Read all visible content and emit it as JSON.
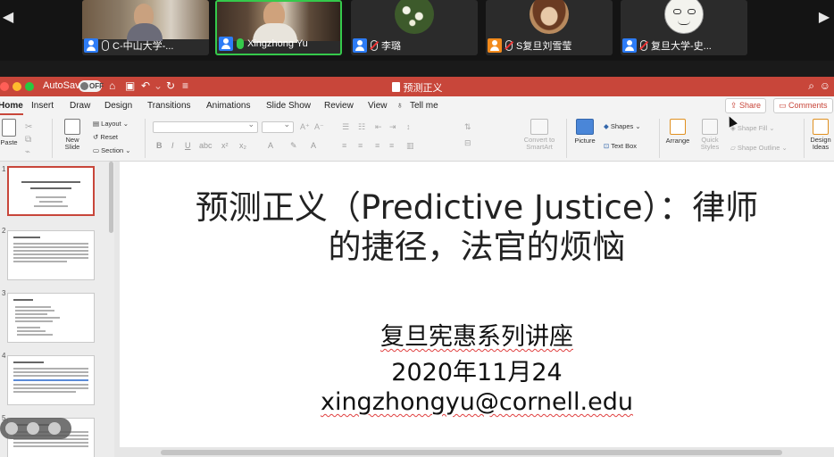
{
  "zoom": {
    "participants": [
      {
        "name": "C-中山大学-...",
        "mic": "on",
        "video": true,
        "icon": "user-icon"
      },
      {
        "name": "Xingzhong Yu",
        "mic": "speaking",
        "video": true,
        "active": true,
        "icon": "user-icon"
      },
      {
        "name": "李璐",
        "mic": "muted",
        "video": false,
        "avatar": "flowers",
        "icon": "user-icon"
      },
      {
        "name": "S复旦刘雪莹",
        "mic": "muted",
        "video": false,
        "avatar": "woman-photo",
        "icon": "user-icon-orange"
      },
      {
        "name": "复旦大学-史...",
        "mic": "muted",
        "video": false,
        "avatar": "cartoon-face",
        "icon": "user-icon"
      }
    ]
  },
  "window": {
    "autosave_label": "AutoSave",
    "autosave_state": "OFF",
    "doc_title": "预测正义"
  },
  "ribbon": {
    "tabs": [
      "Home",
      "Insert",
      "Draw",
      "Design",
      "Transitions",
      "Animations",
      "Slide Show",
      "Review",
      "View",
      "Tell me"
    ],
    "selected_tab": "Home",
    "share_label": "Share",
    "comments_label": "Comments",
    "paste_label": "Paste",
    "new_slide_label": "New Slide",
    "layout_label": "Layout",
    "reset_label": "Reset",
    "section_label": "Section",
    "convert_label": "Convert to SmartArt",
    "picture_label": "Picture",
    "shapes_label": "Shapes",
    "textbox_label": "Text Box",
    "arrange_label": "Arrange",
    "quick_styles_label": "Quick Styles",
    "shape_fill_label": "Shape Fill",
    "shape_outline_label": "Shape Outline",
    "design_ideas_label": "Design Ideas",
    "accent_color": "#c8463a"
  },
  "slide": {
    "title_line1": "预测正义（Predictive Justice）：律师",
    "title_line2": "的捷径，法官的烦恼",
    "series": "复旦宪惠系列讲座",
    "date": "2020年11月24",
    "email": "xingzhongyu@cornell.edu"
  },
  "thumbnails": [
    {
      "num": "1",
      "selected": true
    },
    {
      "num": "2",
      "selected": false
    },
    {
      "num": "3",
      "selected": false
    },
    {
      "num": "4",
      "selected": false
    },
    {
      "num": "5",
      "selected": false
    }
  ]
}
